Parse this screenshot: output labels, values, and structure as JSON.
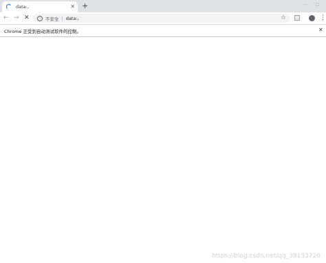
{
  "tab": {
    "title": "data:,"
  },
  "toolbar": {
    "back_icon": "←",
    "forward_icon": "→",
    "stop_icon": "✕",
    "info_icon": "i",
    "security_label": "不安全",
    "separator": "|",
    "url": "data:,",
    "star_icon": "☆",
    "menu_icon": "⋮"
  },
  "infobar": {
    "message": "Chrome 正受到自动测试软件的控制。",
    "close_icon": "✕"
  },
  "new_tab_icon": "+",
  "tab_close_icon": "✕",
  "window_controls": {
    "minimize": "—",
    "maximize": "□"
  },
  "watermark": "https://blog.csdn.net/qq_39153720"
}
